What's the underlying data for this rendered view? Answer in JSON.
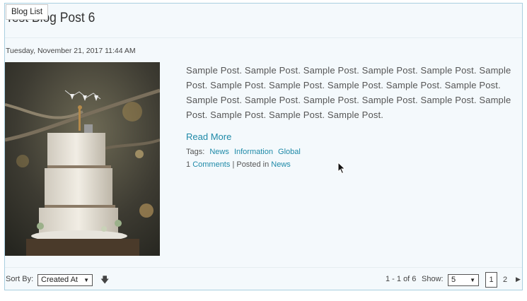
{
  "badge": "Blog List",
  "post": {
    "title": "Test Blog Post 6",
    "date": "Tuesday, November 21, 2017 11:44 AM",
    "excerpt": "Sample Post. Sample Post. Sample Post. Sample Post. Sample Post. Sample Post. Sample Post. Sample Post. Sample Post. Sample Post. Sample Post. Sample Post. Sample Post. Sample Post. Sample Post. Sample Post. Sample Post. Sample Post. Sample Post. Sample Post.",
    "read_more": "Read More",
    "tags_label": "Tags:",
    "tags": [
      "News",
      "Information",
      "Global"
    ],
    "comments_count": "1",
    "comments_label": "Comments",
    "posted_in_label": "| Posted in",
    "category": "News"
  },
  "footer": {
    "sort_label": "Sort By:",
    "sort_value": "Created At",
    "sort_direction_icon": "arrow-down-icon",
    "range": "1 - 1 of 6",
    "show_label": "Show:",
    "show_value": "5",
    "pages": [
      "1",
      "2"
    ],
    "current_page": "1",
    "next_icon": "chevron-right-icon"
  },
  "colors": {
    "accent": "#1f8aa8",
    "panel_bg": "#f4f9fc",
    "panel_border": "#a9cfe0"
  }
}
